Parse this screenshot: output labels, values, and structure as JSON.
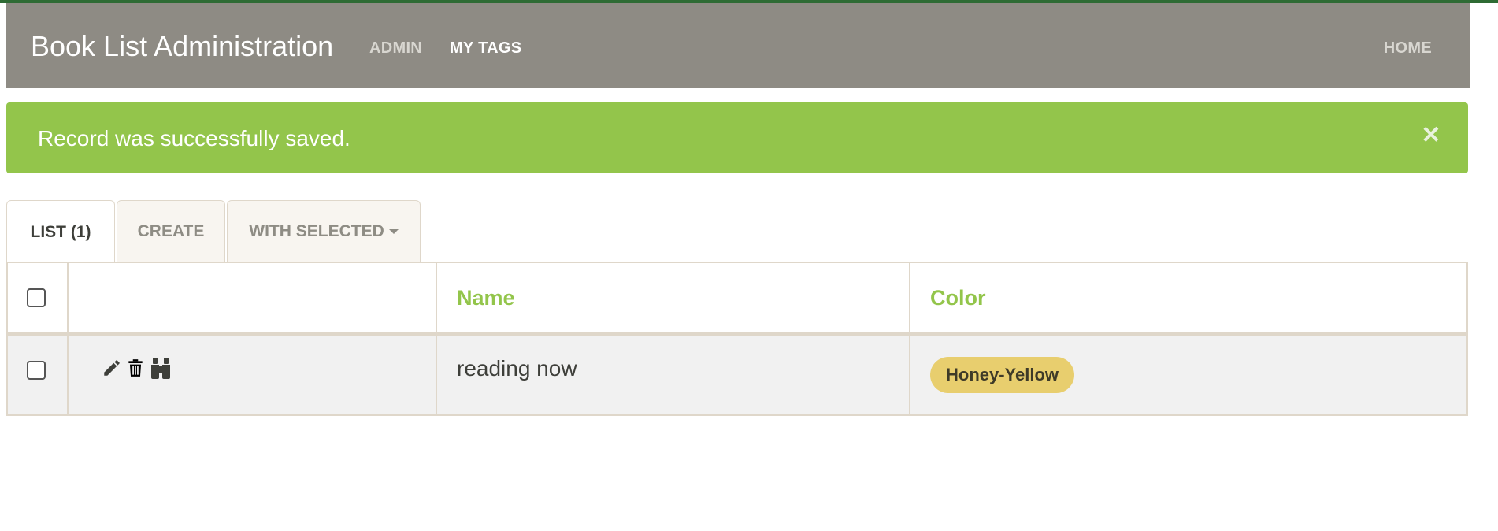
{
  "navbar": {
    "brand": "Book List Administration",
    "links": {
      "admin": "ADMIN",
      "my_tags": "MY TAGS",
      "home": "HOME"
    }
  },
  "alert": {
    "message": "Record was successfully saved.",
    "close_symbol": "×"
  },
  "tabs": {
    "list": "LIST (1)",
    "create": "CREATE",
    "with_selected": "WITH SELECTED"
  },
  "table": {
    "columns": [
      "",
      "",
      "Name",
      "Color"
    ],
    "rows": [
      {
        "name": "reading now",
        "color": "Honey-Yellow",
        "actions": [
          "pencil-icon",
          "trash-icon",
          "binoculars-icon"
        ]
      }
    ]
  },
  "colors": {
    "navbar_bg": "#8e8b84",
    "alert_bg": "#93c54b",
    "header_text": "#93c54b",
    "badge_bg": "#e8ce6e"
  }
}
